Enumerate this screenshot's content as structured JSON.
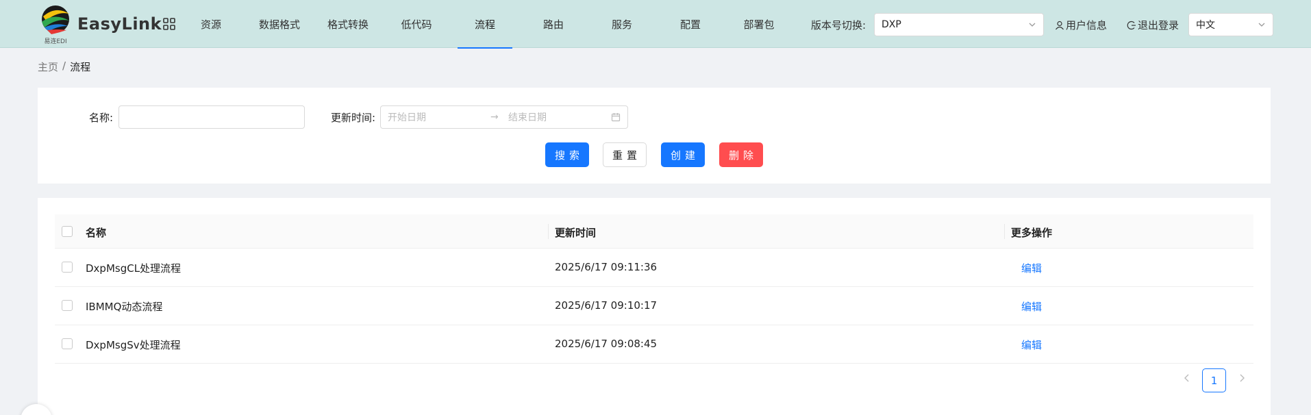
{
  "header": {
    "logo_caption": "易连EDI",
    "brand": "EasyLink",
    "nav": [
      {
        "label": "资源",
        "active": false
      },
      {
        "label": "数据格式",
        "active": false
      },
      {
        "label": "格式转换",
        "active": false
      },
      {
        "label": "低代码",
        "active": false
      },
      {
        "label": "流程",
        "active": true
      },
      {
        "label": "路由",
        "active": false
      },
      {
        "label": "服务",
        "active": false
      },
      {
        "label": "配置",
        "active": false
      },
      {
        "label": "部署包",
        "active": false
      }
    ],
    "version_label": "版本号切换:",
    "version_value": "DXP",
    "user_info": "用户信息",
    "logout": "退出登录",
    "language": "中文"
  },
  "breadcrumb": {
    "home": "主页",
    "separator": "/",
    "current": "流程"
  },
  "search": {
    "name_label": "名称:",
    "name_value": "",
    "time_label": "更新时间:",
    "start_placeholder": "开始日期",
    "end_placeholder": "结束日期",
    "buttons": {
      "search": "搜索",
      "reset": "重置",
      "create": "创建",
      "delete": "删除"
    }
  },
  "table": {
    "columns": [
      "名称",
      "更新时间",
      "更多操作"
    ],
    "rows": [
      {
        "name": "DxpMsgCL处理流程",
        "updated": "2025/6/17 09:11:36",
        "action": "编辑"
      },
      {
        "name": "IBMMQ动态流程",
        "updated": "2025/6/17 09:10:17",
        "action": "编辑"
      },
      {
        "name": "DxpMsgSv处理流程",
        "updated": "2025/6/17 09:08:45",
        "action": "编辑"
      }
    ]
  },
  "pagination": {
    "current_page": "1"
  },
  "colors": {
    "primary": "#1677ff",
    "danger": "#ff4d4f",
    "header_bg": "#cde6e4"
  }
}
